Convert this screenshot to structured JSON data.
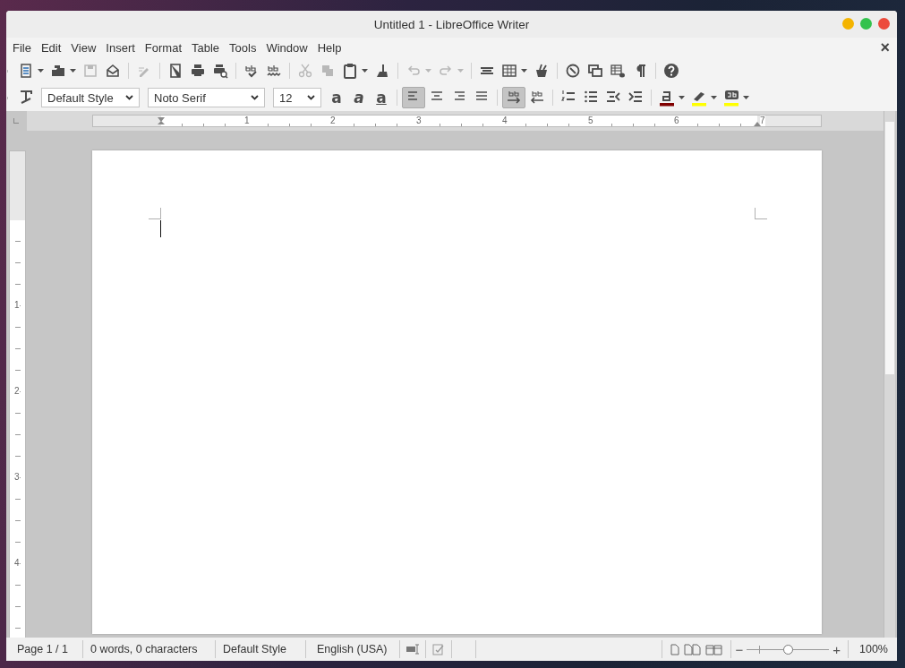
{
  "window": {
    "title": "Untitled 1 - LibreOffice Writer",
    "close_glyph": "×"
  },
  "menu": [
    {
      "label": "File"
    },
    {
      "label": "Edit"
    },
    {
      "label": "View"
    },
    {
      "label": "Insert"
    },
    {
      "label": "Format"
    },
    {
      "label": "Table"
    },
    {
      "label": "Tools"
    },
    {
      "label": "Window"
    },
    {
      "label": "Help"
    }
  ],
  "standard_toolbar": [
    {
      "kind": "split",
      "disabled": false
    },
    {
      "kind": "split",
      "disabled": false
    },
    {
      "kind": "button",
      "disabled": true
    },
    {
      "kind": "button",
      "disabled": false
    },
    {
      "kind": "separator"
    },
    {
      "kind": "button",
      "disabled": true
    },
    {
      "kind": "separator"
    },
    {
      "kind": "button",
      "disabled": false
    },
    {
      "kind": "button",
      "disabled": false
    },
    {
      "kind": "button",
      "disabled": false
    },
    {
      "kind": "separator"
    },
    {
      "kind": "button",
      "disabled": false
    },
    {
      "kind": "button",
      "disabled": false
    },
    {
      "kind": "separator"
    },
    {
      "kind": "button",
      "disabled": true
    },
    {
      "kind": "button",
      "disabled": true
    },
    {
      "kind": "split",
      "disabled": false
    },
    {
      "kind": "button",
      "disabled": false
    },
    {
      "kind": "separator"
    },
    {
      "kind": "split",
      "disabled": true
    },
    {
      "kind": "split",
      "disabled": true
    },
    {
      "kind": "separator"
    },
    {
      "kind": "button",
      "disabled": false
    },
    {
      "kind": "split",
      "disabled": false
    },
    {
      "kind": "button",
      "disabled": false
    },
    {
      "kind": "separator"
    },
    {
      "kind": "button",
      "disabled": false
    },
    {
      "kind": "button",
      "disabled": false
    },
    {
      "kind": "button",
      "disabled": false
    },
    {
      "kind": "button",
      "disabled": false
    },
    {
      "kind": "separator"
    },
    {
      "kind": "button",
      "disabled": false
    }
  ],
  "formatting_toolbar": [
    {
      "kind": "button",
      "selected": false
    },
    {
      "kind": "combo",
      "value": "Default Style"
    },
    {
      "kind": "combo",
      "value": "Noto Serif"
    },
    {
      "kind": "combo",
      "value": "12"
    },
    {
      "kind": "bold",
      "label": "a"
    },
    {
      "kind": "italic",
      "label": "a"
    },
    {
      "kind": "underline",
      "label": "a"
    },
    {
      "kind": "separator"
    },
    {
      "kind": "button",
      "selected": true
    },
    {
      "kind": "button",
      "selected": false
    },
    {
      "kind": "button",
      "selected": false
    },
    {
      "kind": "button",
      "selected": false
    },
    {
      "kind": "separator"
    },
    {
      "kind": "button",
      "selected": true
    },
    {
      "kind": "button",
      "selected": false
    },
    {
      "kind": "separator"
    },
    {
      "kind": "button",
      "selected": false
    },
    {
      "kind": "button",
      "selected": false
    },
    {
      "kind": "button",
      "selected": false
    },
    {
      "kind": "button",
      "selected": false
    },
    {
      "kind": "separator"
    },
    {
      "kind": "split",
      "selected": false,
      "color": "#800000"
    },
    {
      "kind": "split",
      "selected": false,
      "color": "#ffff00"
    },
    {
      "kind": "split",
      "selected": false,
      "color": "#ffff00"
    }
  ],
  "rulers": {
    "horizontal": [
      "1",
      "2",
      "3",
      "4",
      "5",
      "6",
      "7"
    ],
    "vertical": [
      "1",
      "2",
      "3",
      "4"
    ]
  },
  "status_bar": {
    "fields": [
      "Page 1 / 1",
      "0 words, 0 characters",
      "Default Style",
      "English (USA)"
    ],
    "zoom_out": "−",
    "zoom_in": "+",
    "zoom": {
      "level": 0.5
    },
    "zoom_value": "100%"
  }
}
